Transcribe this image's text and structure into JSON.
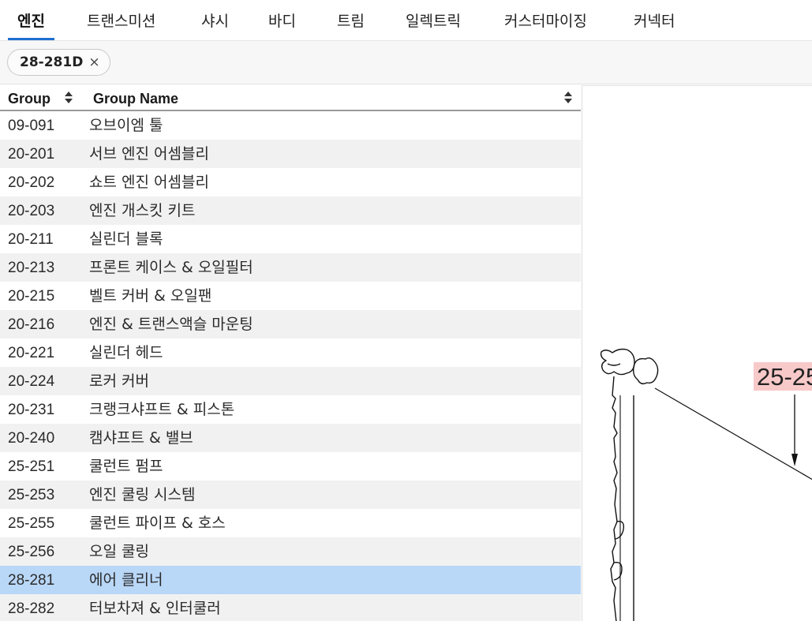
{
  "tabs": [
    {
      "label": "엔진",
      "active": true
    },
    {
      "label": "트랜스미션",
      "active": false
    },
    {
      "label": "샤시",
      "active": false
    },
    {
      "label": "바디",
      "active": false
    },
    {
      "label": "트림",
      "active": false
    },
    {
      "label": "일렉트릭",
      "active": false
    },
    {
      "label": "커스터마이징",
      "active": false
    },
    {
      "label": "커넥터",
      "active": false
    }
  ],
  "filter": {
    "chip_label": "28-281D",
    "chip_close": "×"
  },
  "table": {
    "columns": {
      "group": "Group",
      "group_name": "Group Name"
    },
    "rows": [
      {
        "code": "09-091",
        "name": "오브이엠 툴"
      },
      {
        "code": "20-201",
        "name": "서브 엔진 어셈블리"
      },
      {
        "code": "20-202",
        "name": "쇼트 엔진 어셈블리"
      },
      {
        "code": "20-203",
        "name": "엔진 개스킷 키트"
      },
      {
        "code": "20-211",
        "name": "실린더 블록"
      },
      {
        "code": "20-213",
        "name": "프론트 케이스 & 오일필터"
      },
      {
        "code": "20-215",
        "name": "벨트 커버 & 오일팬"
      },
      {
        "code": "20-216",
        "name": "엔진 & 트랜스액슬 마운팅"
      },
      {
        "code": "20-221",
        "name": "실린더 헤드"
      },
      {
        "code": "20-224",
        "name": "로커 커버"
      },
      {
        "code": "20-231",
        "name": "크랭크샤프트 & 피스톤"
      },
      {
        "code": "20-240",
        "name": "캠샤프트 & 밸브"
      },
      {
        "code": "25-251",
        "name": "쿨런트 펌프"
      },
      {
        "code": "25-253",
        "name": "엔진 쿨링 시스템"
      },
      {
        "code": "25-255",
        "name": "쿨런트 파이프 & 호스"
      },
      {
        "code": "25-256",
        "name": "오일 쿨링"
      },
      {
        "code": "28-281",
        "name": "에어 클리너"
      },
      {
        "code": "28-282",
        "name": "터보차져 & 인터쿨러"
      }
    ],
    "selected_code": "28-281"
  },
  "diagram": {
    "callout_label": "25-25",
    "callout_color": "#f8c9c9"
  },
  "colors": {
    "accent": "#1f6fd1",
    "selected_row": "#b9d7f7",
    "striped_row": "#f1f1f1"
  }
}
